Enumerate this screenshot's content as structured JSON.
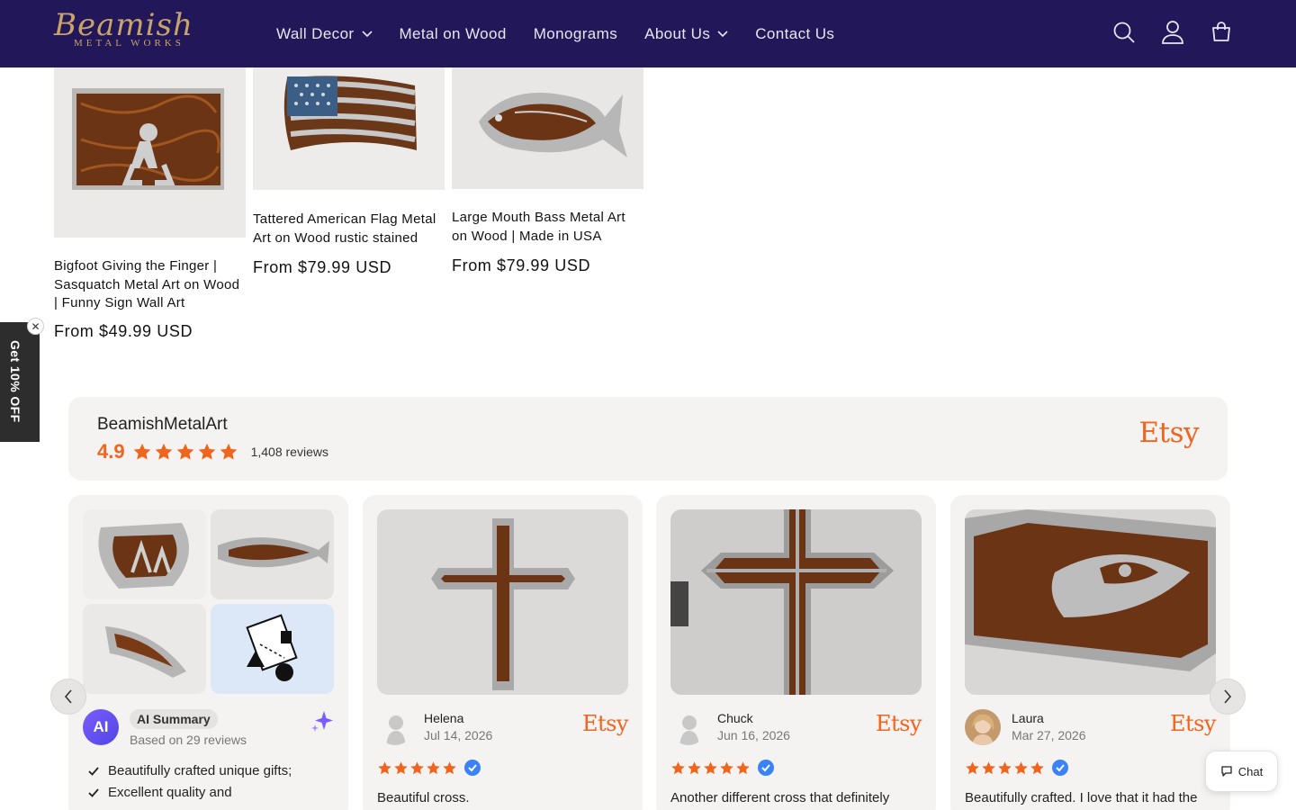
{
  "brand": {
    "logo_main": "Beamish",
    "logo_sub": "METAL WORKS"
  },
  "nav": {
    "wall_decor": "Wall Decor",
    "metal_on_wood": "Metal on Wood",
    "monograms": "Monograms",
    "about_us": "About Us",
    "contact_us": "Contact Us"
  },
  "icons": {
    "search": "search-icon",
    "account": "account-icon",
    "cart": "cart-icon"
  },
  "products": [
    {
      "title": "Bigfoot Giving the Finger | Sasquatch Metal Art on Wood | Funny Sign Wall Art",
      "price": "From $49.99 USD"
    },
    {
      "title": "Tattered American Flag Metal Art on Wood rustic stained",
      "price": "From $79.99 USD"
    },
    {
      "title": "Large Mouth Bass Metal Art on Wood | Made in USA",
      "price": "From $79.99 USD"
    }
  ],
  "discount": {
    "label": "Get 10% OFF",
    "close": "✕"
  },
  "reviews": {
    "shop_name": "BeamishMetalArt",
    "rating": "4.9",
    "count": "1,408 reviews",
    "source": "Etsy",
    "ai_summary": {
      "badge": "AI",
      "label": "AI Summary",
      "based_on": "Based on 29 reviews",
      "points": [
        "Beautifully crafted unique gifts;",
        "Excellent quality and"
      ]
    },
    "items": [
      {
        "name": "Helena",
        "date": "Jul 14, 2026",
        "text": "Beautiful cross.",
        "source": "Etsy"
      },
      {
        "name": "Chuck",
        "date": "Jun 16, 2026",
        "text": "Another different cross that definitely",
        "source": "Etsy"
      },
      {
        "name": "Laura",
        "date": "Mar 27, 2026",
        "text": "Beautifully crafted. I love that it had the",
        "source": "Etsy"
      }
    ]
  },
  "chat": {
    "label": "Chat"
  },
  "colors": {
    "header_bg": "#221759",
    "accent_orange": "#f1641e",
    "verified_blue": "#3b82f6",
    "logo_gold": "#c9a46a"
  }
}
